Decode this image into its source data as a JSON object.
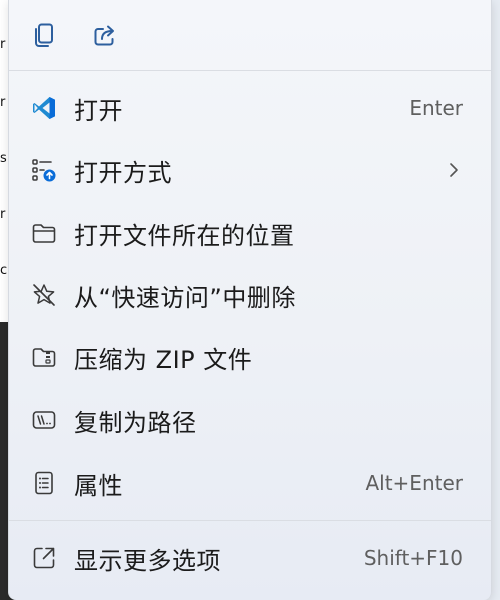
{
  "background": {
    "fragments": [
      "r",
      "r",
      "s",
      "r",
      "c"
    ]
  },
  "toolbar": {
    "copy_icon": "copy-icon",
    "share_icon": "share-icon"
  },
  "menu": {
    "items": [
      {
        "label": "打开",
        "shortcut": "Enter",
        "icon": "vscode-icon"
      },
      {
        "label": "打开方式",
        "shortcut": "",
        "icon": "open-with-icon"
      },
      {
        "label": "打开文件所在的位置",
        "shortcut": "",
        "icon": "folder-icon"
      },
      {
        "label": "从“快速访问”中删除",
        "shortcut": "",
        "icon": "unpin-star-icon"
      },
      {
        "label": "压缩为 ZIP 文件",
        "shortcut": "",
        "icon": "zip-folder-icon"
      },
      {
        "label": "复制为路径",
        "shortcut": "",
        "icon": "copy-path-icon"
      },
      {
        "label": "属性",
        "shortcut": "Alt+Enter",
        "icon": "properties-icon"
      },
      {
        "label": "显示更多选项",
        "shortcut": "Shift+F10",
        "icon": "more-options-icon"
      }
    ]
  },
  "colors": {
    "accent": "#0a6cd8",
    "menu_bg": "#f2f4f8",
    "text": "#1b1b1b",
    "shortcut_text": "#5f5f5f"
  }
}
